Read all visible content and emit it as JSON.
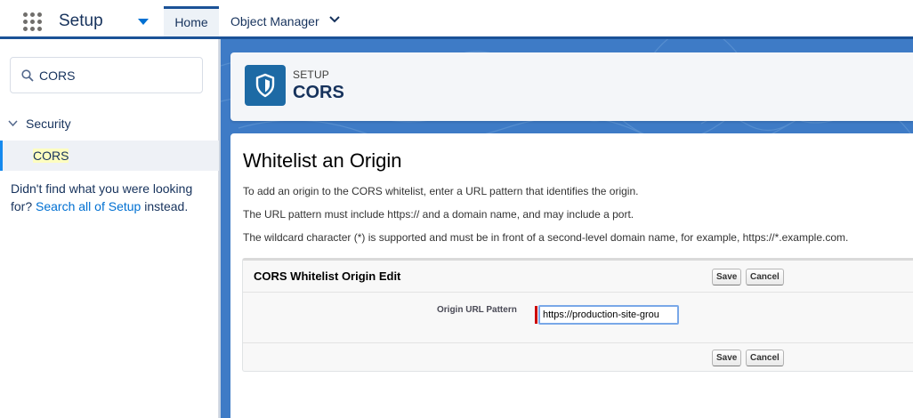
{
  "nav": {
    "app_name": "Setup",
    "tabs": [
      {
        "label": "Home"
      },
      {
        "label": "Object Manager"
      }
    ]
  },
  "sidebar": {
    "quick_find_value": "CORS",
    "tree": {
      "parent_label": "Security",
      "selected_child_label": "CORS"
    },
    "not_found": {
      "prefix": "Didn't find what you were looking for?",
      "link": "Search all of Setup",
      "suffix": "instead."
    }
  },
  "header": {
    "eyebrow": "SETUP",
    "title": "CORS",
    "icon": "shield-icon"
  },
  "content": {
    "heading": "Whitelist an Origin",
    "paragraphs": [
      "To add an origin to the CORS whitelist, enter a URL pattern that identifies the origin.",
      "The URL pattern must include https:// and a domain name, and may include a port.",
      "The wildcard character (*) is supported and must be in front of a second-level domain name, for example, https://*.example.com."
    ]
  },
  "edit_block": {
    "title": "CORS Whitelist Origin Edit",
    "save_label": "Save",
    "cancel_label": "Cancel",
    "field_label": "Origin URL Pattern",
    "field_value": "https://production-site-grou",
    "required": true
  },
  "colors": {
    "brand_blue": "#1b5297",
    "link_blue": "#0070d2",
    "header_icon_bg": "#1d6aa5",
    "background_pattern": "#3e7bc6",
    "required_red": "#cc0000"
  }
}
